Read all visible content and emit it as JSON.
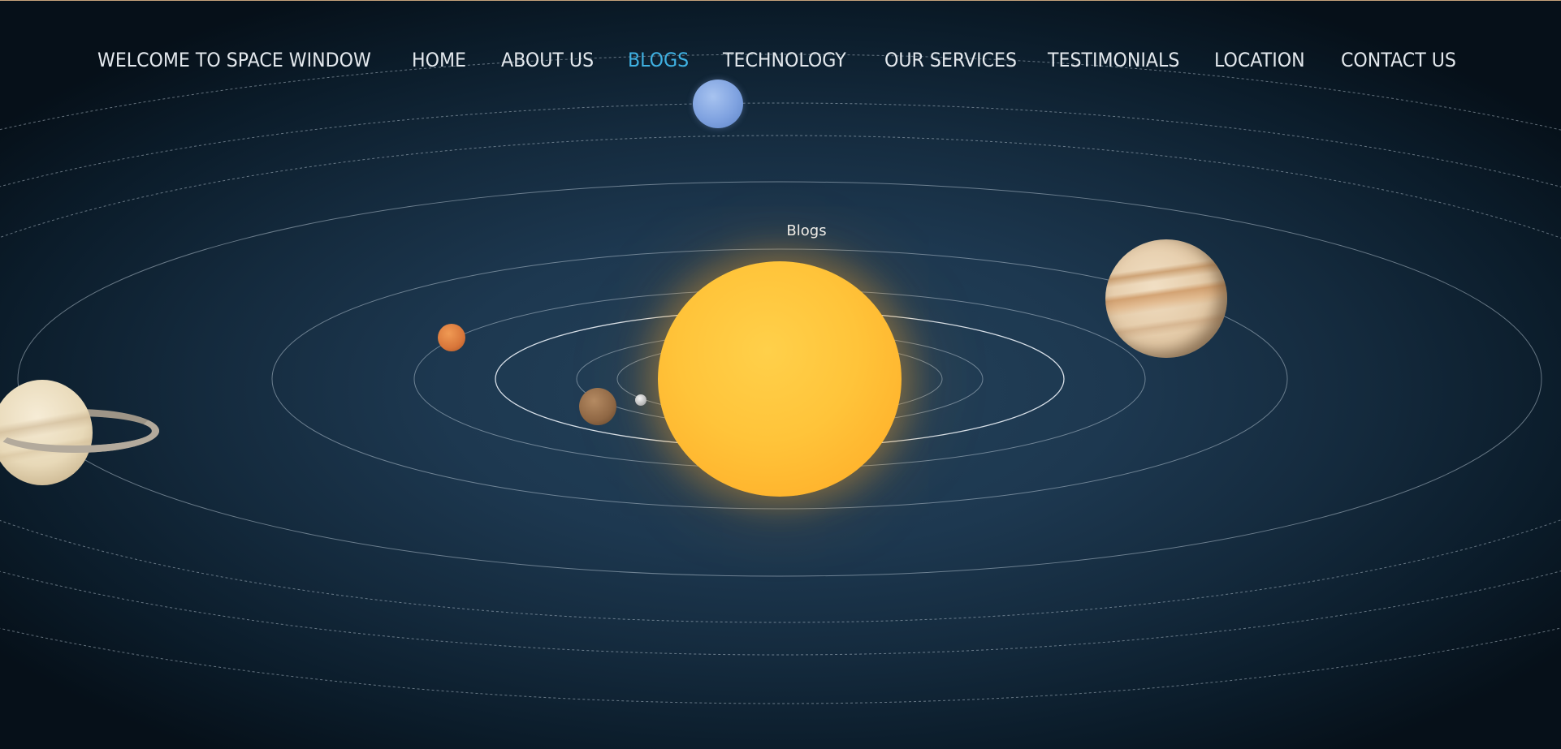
{
  "nav": {
    "items": [
      {
        "label": "WELCOME TO SPACE WINDOW",
        "active": false
      },
      {
        "label": "HOME",
        "active": false
      },
      {
        "label": "ABOUT US",
        "active": false
      },
      {
        "label": "BLOGS",
        "active": true
      },
      {
        "label": "TECHNOLOGY",
        "active": false
      },
      {
        "label": "OUR SERVICES",
        "active": false
      },
      {
        "label": "TESTIMONIALS",
        "active": false
      },
      {
        "label": "LOCATION",
        "active": false
      },
      {
        "label": "CONTACT US",
        "active": false
      }
    ],
    "active_color": "#3fb1e2",
    "text_color": "#e3e8ed"
  },
  "solar_system": {
    "center_label": "Blogs",
    "bodies": [
      "sun-icon",
      "mercury-icon",
      "venus-icon",
      "mars-icon",
      "jupiter-icon",
      "saturn-icon",
      "neptune-icon"
    ]
  },
  "colors": {
    "background": "#1d3850",
    "sun": "#ffc43a"
  }
}
